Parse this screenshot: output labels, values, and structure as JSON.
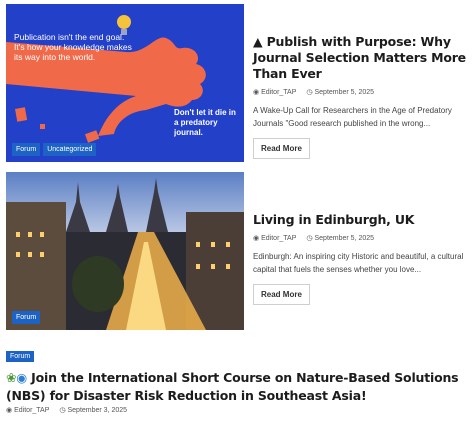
{
  "posts": [
    {
      "title": "Publish with Purpose: Why Journal Selection Matters More Than Ever",
      "title_icon": "graduation-cap-icon",
      "author": "Editor_TAP",
      "date": "September 5, 2025",
      "excerpt": "A Wake-Up Call for Researchers in the Age of Predatory Journals \"Good research published in the wrong...",
      "read_more": "Read More",
      "badges": [
        "Forum",
        "Uncategorized"
      ],
      "image_text_main": "Publication isn't the end goal. It's how your knowledge makes its way into the world.",
      "image_text_side": "Don't let it die in a predatory journal."
    },
    {
      "title": "Living in Edinburgh, UK",
      "author": "Editor_TAP",
      "date": "September 5, 2025",
      "excerpt": "Edinburgh: An inspiring city Historic and beautiful, a cultural capital that fuels the senses whether you love...",
      "read_more": "Read More",
      "badges": [
        "Forum"
      ]
    },
    {
      "badge": "Forum",
      "title_icons": [
        "seedling-icon",
        "globe-icon"
      ],
      "title": "Join the International Short Course on Nature-Based Solutions (NBS) for Disaster Risk Reduction in Southeast Asia!",
      "author": "Editor_TAP",
      "date": "September 3, 2025"
    }
  ],
  "colors": {
    "badge": "#1d63c6",
    "image_blue": "#2340c8",
    "image_orange": "#f06a4a"
  }
}
